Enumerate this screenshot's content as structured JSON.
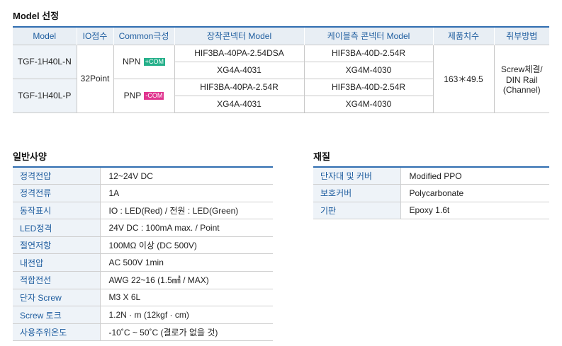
{
  "model_section": {
    "title": "Model 선정",
    "headers": [
      "Model",
      "IO점수",
      "Common극성",
      "장착콘넥터 Model",
      "케이블측 콘넥터 Model",
      "제품치수",
      "취부방법"
    ],
    "io_points": "32Point",
    "dimensions": "163＊49.5",
    "mounting_lines": [
      "Screw체결/",
      "DIN Rail",
      "(Channel)"
    ],
    "models": [
      {
        "name": "TGF-1H40L-N",
        "polarity": "NPN",
        "tag": "+COM",
        "rows": [
          {
            "mount": "HIF3BA-40PA-2.54DSA",
            "cable": "HIF3BA-40D-2.54R"
          },
          {
            "mount": "XG4A-4031",
            "cable": "XG4M-4030"
          }
        ]
      },
      {
        "name": "TGF-1H40L-P",
        "polarity": "PNP",
        "tag": "-COM",
        "rows": [
          {
            "mount": "HIF3BA-40PA-2.54R",
            "cable": "HIF3BA-40D-2.54R"
          },
          {
            "mount": "XG4A-4031",
            "cable": "XG4M-4030"
          }
        ]
      }
    ]
  },
  "general_section": {
    "title": "일반사양",
    "rows": [
      {
        "key": "정격전압",
        "value": "12~24V DC"
      },
      {
        "key": "정격전류",
        "value": "1A"
      },
      {
        "key": "동작표시",
        "value": "IO : LED(Red) / 전원 : LED(Green)"
      },
      {
        "key": "LED정격",
        "value": "24V DC : 100mA max. / Point"
      },
      {
        "key": "절연저항",
        "value": "100MΩ 이상 (DC 500V)"
      },
      {
        "key": "내전압",
        "value": "AC 500V 1min"
      },
      {
        "key": "적합전선",
        "value": "AWG 22~16 (1.5㎟ / MAX)"
      },
      {
        "key": "단자 Screw",
        "value": "M3 X 6L"
      },
      {
        "key": "Screw 토크",
        "value": "1.2N · m (12kgf · cm)"
      },
      {
        "key": "사용주위온도",
        "value": "-10˚C ~ 50˚C (결로가 없을 것)"
      }
    ]
  },
  "material_section": {
    "title": "재질",
    "rows": [
      {
        "key": "단자대 및 커버",
        "value": "Modified PPO"
      },
      {
        "key": "보호커버",
        "value": "Polycarbonate"
      },
      {
        "key": "기판",
        "value": "Epoxy 1.6t"
      }
    ]
  },
  "colors": {
    "accent": "#2f6db0",
    "header_bg": "#e8eef4",
    "label_text": "#1d5c9e",
    "tag_plus": "#25b08a",
    "tag_minus": "#e0348f"
  }
}
